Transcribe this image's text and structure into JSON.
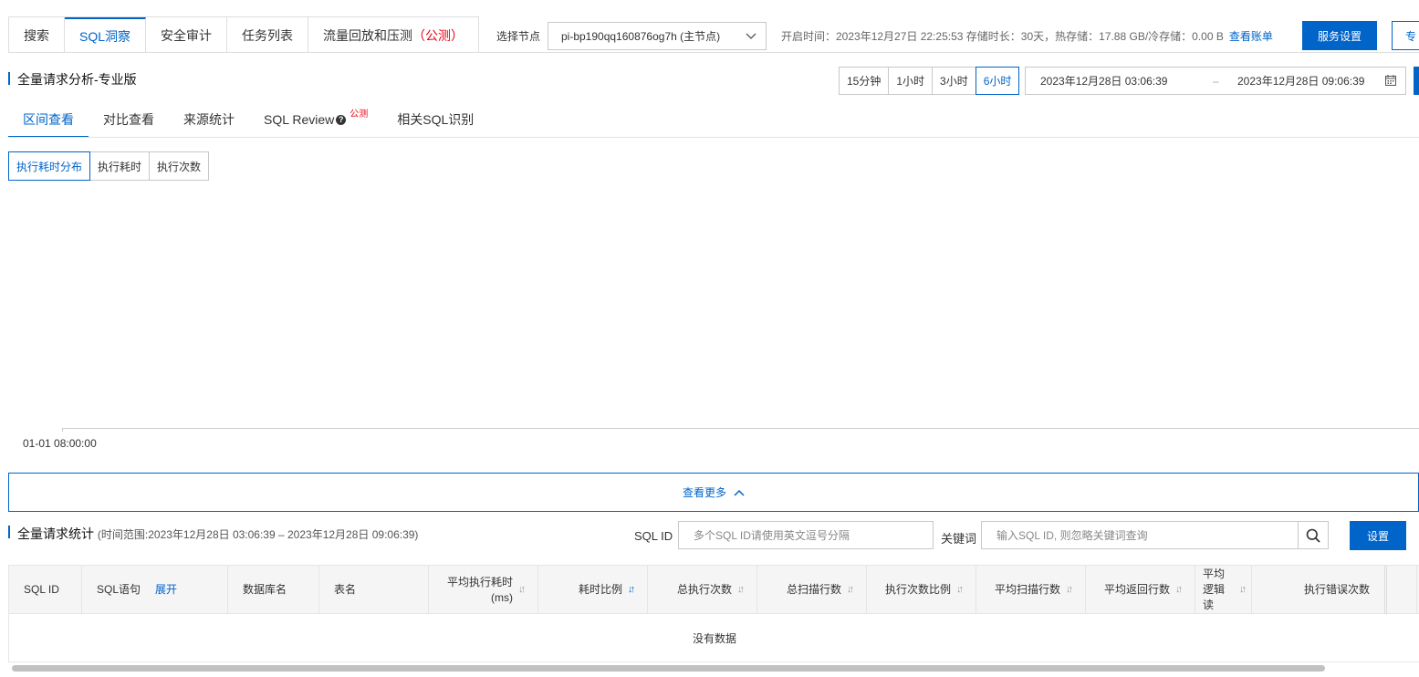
{
  "top_tabs": [
    {
      "label": "搜索"
    },
    {
      "label": "SQL洞察"
    },
    {
      "label": "安全审计"
    },
    {
      "label": "任务列表"
    },
    {
      "label": "流量回放和压测",
      "badge": "（公测）"
    }
  ],
  "node": {
    "label": "选择节点",
    "selected": "pi-bp190qq160876og7h (主节点)"
  },
  "meta": {
    "text": "开启时间：2023年12月27日 22:25:53  存储时长：30天，热存储：17.88 GB/冷存储：0.00 B",
    "bill_link": "查看账单"
  },
  "header_buttons": {
    "service_settings": "服务设置",
    "cut_button": "专"
  },
  "analysis": {
    "title": "全量请求分析-专业版",
    "ranges": [
      "15分钟",
      "1小时",
      "3小时",
      "6小时"
    ],
    "active_range": "6小时",
    "start": "2023年12月28日 03:06:39",
    "sep": "–",
    "end": "2023年12月28日 09:06:39"
  },
  "sub_tabs": [
    {
      "label": "区间查看"
    },
    {
      "label": "对比查看"
    },
    {
      "label": "来源统计"
    },
    {
      "label": "SQL Review",
      "help": "?",
      "badge": "公测"
    },
    {
      "label": "相关SQL识别"
    }
  ],
  "chart_modes": [
    "执行耗时分布",
    "执行耗时",
    "执行次数"
  ],
  "chart_data": {
    "type": "line",
    "x": [
      "01-01 08:00:00"
    ],
    "series": []
  },
  "more": {
    "label": "查看更多"
  },
  "stats": {
    "title": "全量请求统计",
    "subtitle": "(时间范围:2023年12月28日 03:06:39 – 2023年12月28日 09:06:39)",
    "sqlid_label": "SQL ID",
    "sqlid_placeholder": "多个SQL ID请使用英文逗号分隔",
    "kw_label": "关键词",
    "kw_placeholder": "输入SQL ID, 则忽略关键词查询",
    "settings_button": "设置"
  },
  "table": {
    "columns": [
      "SQL ID",
      "SQL语句",
      "数据库名",
      "表名",
      "平均执行耗时 (ms)",
      "耗时比例",
      "总执行次数",
      "总扫描行数",
      "执行次数比例",
      "平均扫描行数",
      "平均返回行数",
      "平均逻辑读",
      "执行错误次数"
    ],
    "expand_link": "展开",
    "empty_text": "没有数据",
    "rows": []
  }
}
